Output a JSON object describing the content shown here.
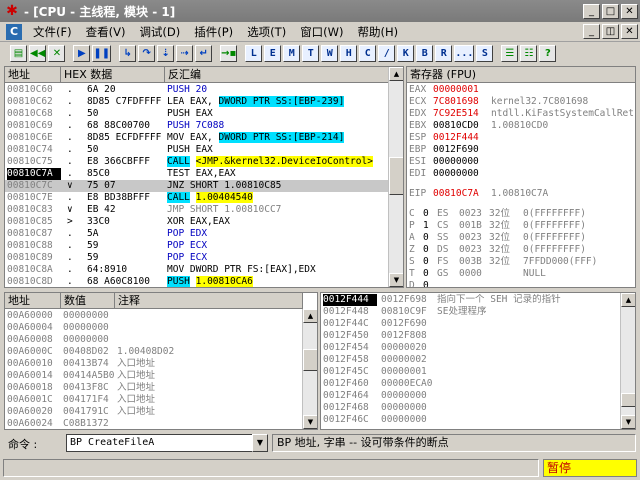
{
  "window": {
    "title": "- [CPU - 主线程, 模块 - 1]"
  },
  "menu": [
    "文件(F)",
    "查看(V)",
    "调试(D)",
    "插件(P)",
    "选项(T)",
    "窗口(W)",
    "帮助(H)"
  ],
  "toolbar": {
    "letters": [
      "L",
      "E",
      "M",
      "T",
      "W",
      "H",
      "C",
      "/",
      "K",
      "B",
      "R",
      "...",
      "S"
    ]
  },
  "disasm": {
    "headers": [
      "地址",
      "HEX 数据",
      "反汇编"
    ],
    "rows": [
      {
        "addr": "00810C60",
        "mark": ".",
        "hex": "6A 20",
        "asm": "PUSH 20",
        "asmcolor": "blue"
      },
      {
        "addr": "00810C62",
        "mark": ".",
        "hex": "8D85 C7FDFFFF",
        "asm": "LEA EAX,",
        "asm2": "DWORD PTR SS:[EBP-239]",
        "hl": "cyan"
      },
      {
        "addr": "00810C68",
        "mark": ".",
        "hex": "50",
        "asm": "PUSH EAX"
      },
      {
        "addr": "00810C69",
        "mark": ".",
        "hex": "68 88C00700",
        "asm": "PUSH 7C088",
        "asmcolor": "blue"
      },
      {
        "addr": "00810C6E",
        "mark": ".",
        "hex": "8D85 ECFDFFFF",
        "asm": "MOV EAX,",
        "asm2": "DWORD PTR SS:[EBP-214]",
        "hl": "cyan"
      },
      {
        "addr": "00810C74",
        "mark": ".",
        "hex": "50",
        "asm": "PUSH EAX"
      },
      {
        "addr": "00810C75",
        "mark": ".",
        "hex": "E8 366CBFFF",
        "asm": "CALL",
        "asm2": "<JMP.&kernel32.DeviceIoControl>",
        "hl": "yellow",
        "asmhl": "cyan"
      },
      {
        "addr": "00810C7A",
        "mark": ".",
        "hex": "85C0",
        "asm": "TEST EAX,EAX",
        "selected": true
      },
      {
        "addr": "00810C7C",
        "mark": "∨",
        "hex": "75 07",
        "asm": "JNZ SHORT 1.00810C85",
        "rowhl": true
      },
      {
        "addr": "00810C7E",
        "mark": ".",
        "hex": "E8 BD38BFFF",
        "asm": "CALL",
        "asm2": "1.00404540",
        "hl": "yellow",
        "asmhl": "cyan"
      },
      {
        "addr": "00810C83",
        "mark": "∨",
        "hex": "EB 42",
        "asm": "JMP SHORT 1.00810CC7",
        "asmcolor": "gray"
      },
      {
        "addr": "00810C85",
        "mark": ">",
        "hex": "33C0",
        "asm": "XOR EAX,EAX"
      },
      {
        "addr": "00810C87",
        "mark": ".",
        "hex": "5A",
        "asm": "POP EDX",
        "asmcolor": "blue"
      },
      {
        "addr": "00810C88",
        "mark": ".",
        "hex": "59",
        "asm": "POP ECX",
        "asmcolor": "blue"
      },
      {
        "addr": "00810C89",
        "mark": ".",
        "hex": "59",
        "asm": "POP ECX",
        "asmcolor": "blue"
      },
      {
        "addr": "00810C8A",
        "mark": ".",
        "hex": "64:8910",
        "asm": "MOV DWORD PTR FS:[EAX],EDX"
      },
      {
        "addr": "00810C8D",
        "mark": ".",
        "hex": "68 A60C8100",
        "asm": "PUSH",
        "asm2": "1.00810CA6",
        "hl": "yellow",
        "asmhl": "cyan"
      }
    ]
  },
  "registers": {
    "header": "寄存器 (FPU)",
    "gp": [
      {
        "name": "EAX",
        "value": "00000001",
        "changed": true,
        "comment": ""
      },
      {
        "name": "ECX",
        "value": "7C801698",
        "changed": true,
        "comment": "kernel32.7C801698"
      },
      {
        "name": "EDX",
        "value": "7C92E514",
        "changed": true,
        "comment": "ntdll.KiFastSystemCallRet"
      },
      {
        "name": "EBX",
        "value": "00810CD0",
        "changed": false,
        "comment": "1.00810CD0"
      },
      {
        "name": "ESP",
        "value": "0012F444",
        "changed": true,
        "comment": ""
      },
      {
        "name": "EBP",
        "value": "0012F690",
        "changed": false,
        "comment": ""
      },
      {
        "name": "ESI",
        "value": "00000000",
        "changed": false,
        "comment": ""
      },
      {
        "name": "EDI",
        "value": "00000000",
        "changed": false,
        "comment": ""
      }
    ],
    "eip": {
      "name": "EIP",
      "value": "00810C7A",
      "comment": "1.00810C7A"
    },
    "flags": [
      {
        "flag": "C",
        "bit": "0",
        "seg": "ES",
        "sel": "0023",
        "width": "32位",
        "info": "0(FFFFFFFF)"
      },
      {
        "flag": "P",
        "bit": "1",
        "seg": "CS",
        "sel": "001B",
        "width": "32位",
        "info": "0(FFFFFFFF)"
      },
      {
        "flag": "A",
        "bit": "0",
        "seg": "SS",
        "sel": "0023",
        "width": "32位",
        "info": "0(FFFFFFFF)"
      },
      {
        "flag": "Z",
        "bit": "0",
        "seg": "DS",
        "sel": "0023",
        "width": "32位",
        "info": "0(FFFFFFFF)"
      },
      {
        "flag": "S",
        "bit": "0",
        "seg": "FS",
        "sel": "003B",
        "width": "32位",
        "info": "7FFDD000(FFF)"
      },
      {
        "flag": "T",
        "bit": "0",
        "seg": "GS",
        "sel": "0000",
        "width": "",
        "info": "NULL"
      },
      {
        "flag": "D",
        "bit": "0",
        "seg": "",
        "sel": "",
        "width": "",
        "info": ""
      }
    ]
  },
  "dump": {
    "headers": [
      "地址",
      "数值",
      "注释"
    ],
    "rows": [
      {
        "addr": "00A60000",
        "value": "00000000",
        "comment": ""
      },
      {
        "addr": "00A60004",
        "value": "00000000",
        "comment": ""
      },
      {
        "addr": "00A60008",
        "value": "00000000",
        "comment": ""
      },
      {
        "addr": "00A6000C",
        "value": "00408D02",
        "comment": "1.00408D02"
      },
      {
        "addr": "00A60010",
        "value": "00413B74",
        "comment": "入口地址"
      },
      {
        "addr": "00A60014",
        "value": "00414A5B0",
        "comment": "入口地址"
      },
      {
        "addr": "00A60018",
        "value": "00413F8C",
        "comment": "入口地址"
      },
      {
        "addr": "00A6001C",
        "value": "004171F4",
        "comment": "入口地址"
      },
      {
        "addr": "00A60020",
        "value": "0041791C",
        "comment": "入口地址"
      },
      {
        "addr": "00A60024",
        "value": "C08B1372",
        "comment": ""
      }
    ]
  },
  "stack": {
    "rows": [
      {
        "addr": "0012F444",
        "value": "0012F698",
        "comment": "指向下一个 SEH 记录的指针",
        "selected": true
      },
      {
        "addr": "0012F448",
        "value": "00810C9F",
        "comment": "SE处理程序"
      },
      {
        "addr": "0012F44C",
        "value": "0012F690",
        "comment": ""
      },
      {
        "addr": "0012F450",
        "value": "0012F808",
        "comment": ""
      },
      {
        "addr": "0012F454",
        "value": "00000020",
        "comment": ""
      },
      {
        "addr": "0012F458",
        "value": "00000002",
        "comment": ""
      },
      {
        "addr": "0012F45C",
        "value": "00000001",
        "comment": ""
      },
      {
        "addr": "0012F460",
        "value": "00000ECA0",
        "comment": ""
      },
      {
        "addr": "0012F464",
        "value": "00000000",
        "comment": ""
      },
      {
        "addr": "0012F468",
        "value": "00000000",
        "comment": ""
      },
      {
        "addr": "0012F46C",
        "value": "00000000",
        "comment": ""
      }
    ]
  },
  "command": {
    "label": "命令 :",
    "value": "BP CreateFileA",
    "hint": "BP 地址, 字串 -- 设可带条件的断点"
  },
  "status": {
    "main": "",
    "state": "暂停"
  }
}
